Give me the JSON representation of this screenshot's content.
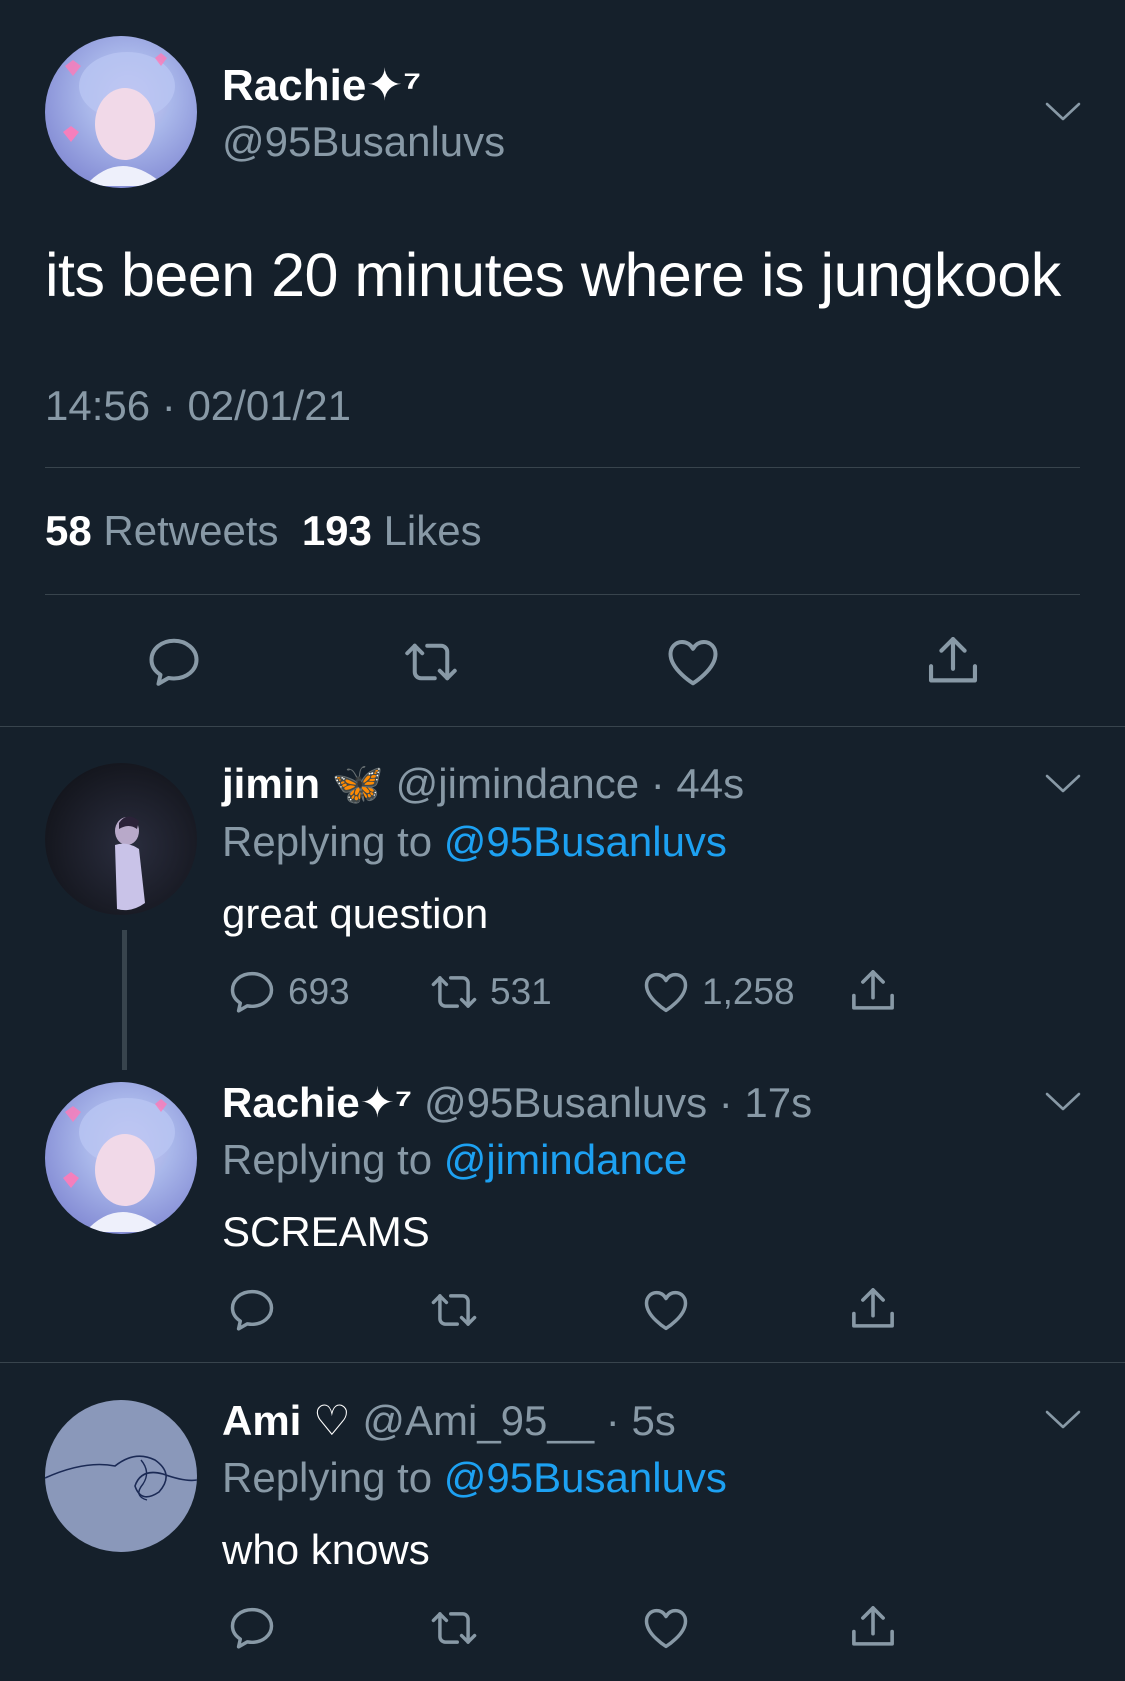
{
  "main_tweet": {
    "name": "Rachie",
    "name_suffix": "✦⁷",
    "handle": "@95Busanluvs",
    "text": "its been 20 minutes where is jungkook",
    "time": "14:56",
    "separator": "·",
    "date": "02/01/21",
    "retweets_count": "58",
    "retweets_label": "Retweets",
    "likes_count": "193",
    "likes_label": "Likes"
  },
  "replies": [
    {
      "name": "jimin",
      "badge": "🦋",
      "handle": "@jimindance",
      "age": "· 44s",
      "replying_label": "Replying to",
      "replying_to": "@95Busanluvs",
      "text": "great question",
      "replies": "693",
      "retweets": "531",
      "likes": "1,258"
    },
    {
      "name": "Rachie",
      "badge": "✦⁷",
      "handle": "@95Busanluvs",
      "age": "· 17s",
      "replying_label": "Replying to",
      "replying_to": "@jimindance",
      "text": "SCREAMS"
    },
    {
      "name": "Ami",
      "badge": "♡",
      "handle": "@Ami_95__",
      "age": "· 5s",
      "replying_label": "Replying to",
      "replying_to": "@95Busanluvs",
      "text": "who knows"
    }
  ],
  "colors": {
    "background": "#15202b",
    "muted": "#8899a6",
    "link": "#1da1f2",
    "divider": "#38444d"
  },
  "icons": [
    "chevron-down-icon",
    "reply-icon",
    "retweet-icon",
    "like-icon",
    "share-icon"
  ]
}
